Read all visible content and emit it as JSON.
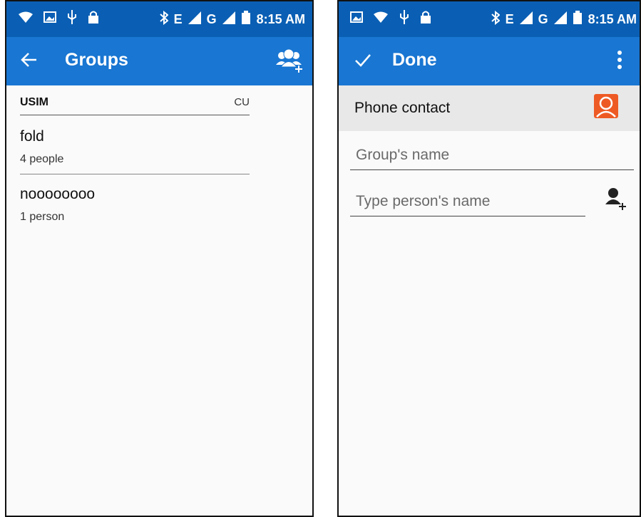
{
  "status_bar": {
    "time": "8:15 AM",
    "network_1": "E",
    "network_2": "G"
  },
  "groups_screen": {
    "title": "Groups",
    "account_label": "USIM",
    "account_short": "CU",
    "groups": [
      {
        "name": "fold",
        "count": "4 people"
      },
      {
        "name": "noooooooo",
        "count": "1 person"
      }
    ]
  },
  "edit_screen": {
    "title": "Done",
    "account_label": "Phone contact",
    "group_name_placeholder": "Group's name",
    "person_placeholder": "Type person's name"
  },
  "colors": {
    "status_bar": "#0a5fb4",
    "app_bar": "#1976d2",
    "avatar": "#ee5a24"
  }
}
